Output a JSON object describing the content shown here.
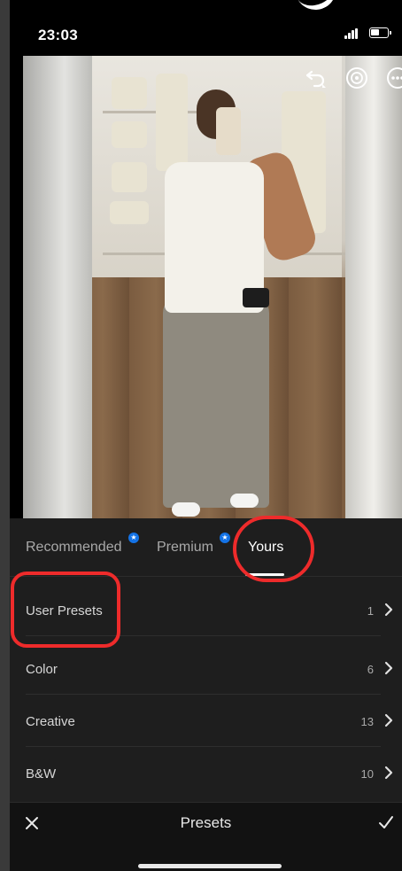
{
  "status_bar": {
    "time": "23:03"
  },
  "tabs": [
    {
      "label": "Recommended",
      "badge": true,
      "active": false
    },
    {
      "label": "Premium",
      "badge": true,
      "active": false
    },
    {
      "label": "Yours",
      "badge": false,
      "active": true
    }
  ],
  "list": [
    {
      "label": "User Presets",
      "count": "1"
    },
    {
      "label": "Color",
      "count": "6"
    },
    {
      "label": "Creative",
      "count": "13"
    },
    {
      "label": "B&W",
      "count": "10"
    }
  ],
  "bottom_bar": {
    "title": "Presets"
  },
  "colors": {
    "annotation": "#ee2b2b",
    "badge": "#1473e6",
    "panel": "#1e1e1e"
  },
  "icons": [
    "undo-icon",
    "help-icon",
    "more-icon",
    "chevron-right-icon",
    "close-icon",
    "check-icon",
    "star-badge-icon"
  ]
}
